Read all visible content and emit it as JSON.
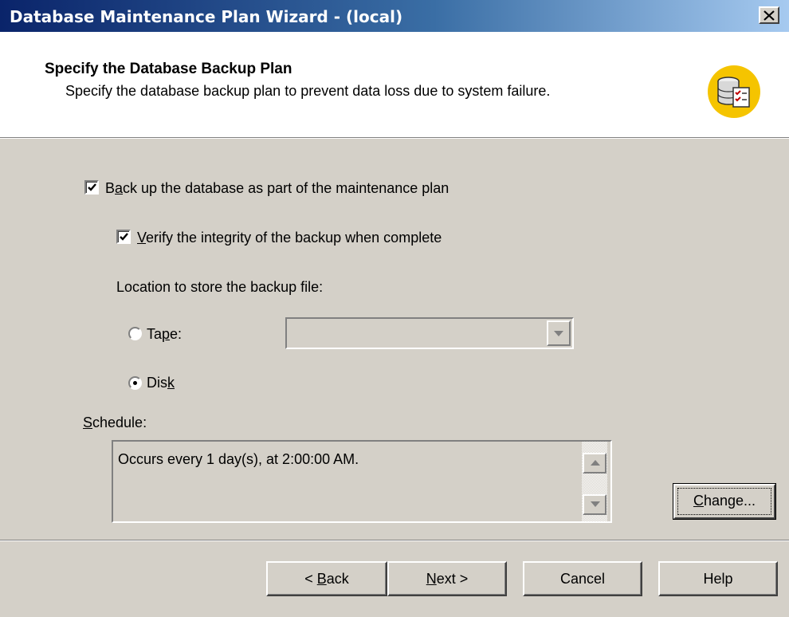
{
  "window": {
    "title": "Database Maintenance Plan Wizard - (local)",
    "close_icon": "close-icon"
  },
  "header": {
    "title": "Specify the Database Backup Plan",
    "subtitle": "Specify the database backup plan to prevent data loss due to system failure.",
    "icon": "database-checklist-icon"
  },
  "options": {
    "backup": {
      "pre": "B",
      "key": "a",
      "post": "ck up the database as part of the maintenance plan",
      "checked": true
    },
    "verify": {
      "pre": "",
      "key": "V",
      "post": "erify the integrity of the backup when complete",
      "checked": true
    },
    "location_label": "Location to store the backup file:",
    "tape": {
      "pre": "Ta",
      "key": "p",
      "post": "e:",
      "selected": false
    },
    "tape_value": "",
    "disk": {
      "pre": "Dis",
      "key": "k",
      "post": "",
      "selected": true
    }
  },
  "schedule": {
    "label_key": "S",
    "label_rest": "chedule:",
    "text": "Occurs every 1 day(s), at 2:00:00 AM.",
    "change": {
      "pre": "",
      "key": "C",
      "post": "hange..."
    }
  },
  "footer": {
    "back": {
      "pre": "< ",
      "key": "B",
      "post": "ack"
    },
    "next": {
      "pre": "",
      "key": "N",
      "post": "ext >"
    },
    "cancel": "Cancel",
    "help": "Help"
  },
  "colors": {
    "titlebar_start": "#0a246a",
    "titlebar_end": "#a6caf0",
    "dialog_face": "#d4d0c8",
    "header_icon_bg": "#f5c400"
  }
}
